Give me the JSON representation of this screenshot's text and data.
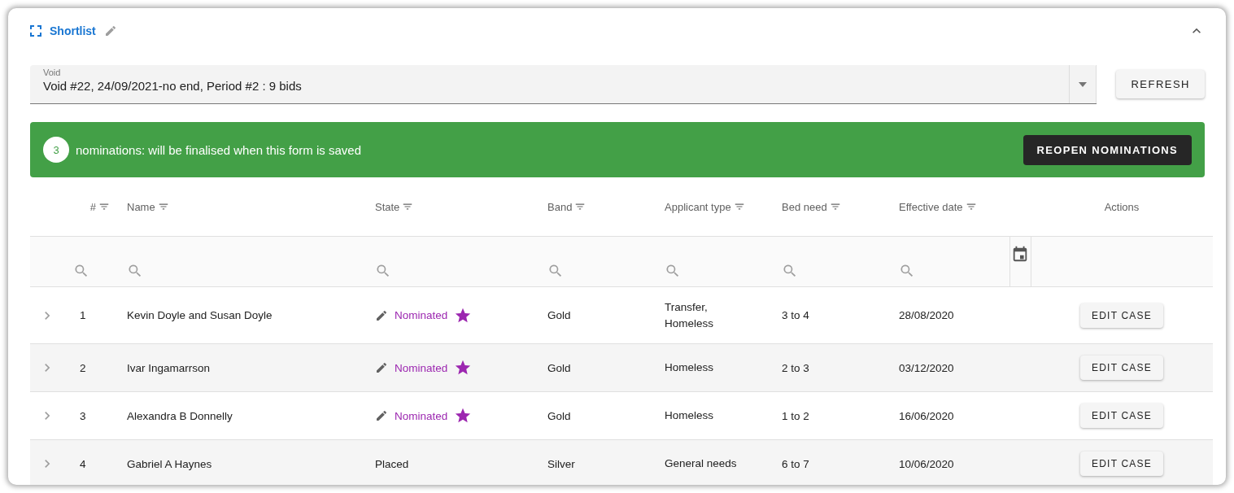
{
  "panel": {
    "title": "Shortlist"
  },
  "void_select": {
    "label": "Void",
    "value": "Void #22, 24/09/2021-no end, Period #2 : 9 bids"
  },
  "refresh_button": "REFRESH",
  "banner": {
    "count": "3",
    "message": "nominations: will be finalised when this form is saved",
    "button": "REOPEN NOMINATIONS"
  },
  "table": {
    "columns": [
      {
        "label": "#",
        "filter": true
      },
      {
        "label": "Name",
        "filter": true
      },
      {
        "label": "State",
        "filter": true
      },
      {
        "label": "Band",
        "filter": true
      },
      {
        "label": "Applicant type",
        "filter": true
      },
      {
        "label": "Bed need",
        "filter": true
      },
      {
        "label": "Effective date",
        "filter": true
      },
      {
        "label": "Actions",
        "filter": false
      }
    ],
    "rows": [
      {
        "num": "1",
        "name": "Kevin Doyle and Susan Doyle",
        "state": {
          "kind": "nominated",
          "text": "Nominated"
        },
        "band": "Gold",
        "applicant_type": "Transfer, Homeless",
        "bed_need": "3 to 4",
        "effective_date": "28/08/2020",
        "action": "EDIT CASE"
      },
      {
        "num": "2",
        "name": "Ivar Ingamarrson",
        "state": {
          "kind": "nominated",
          "text": "Nominated"
        },
        "band": "Gold",
        "applicant_type": "Homeless",
        "bed_need": "2 to 3",
        "effective_date": "03/12/2020",
        "action": "EDIT CASE"
      },
      {
        "num": "3",
        "name": "Alexandra B Donnelly",
        "state": {
          "kind": "nominated",
          "text": "Nominated"
        },
        "band": "Gold",
        "applicant_type": "Homeless",
        "bed_need": "1 to 2",
        "effective_date": "16/06/2020",
        "action": "EDIT CASE"
      },
      {
        "num": "4",
        "name": "Gabriel A Haynes",
        "state": {
          "kind": "plain",
          "text": "Placed"
        },
        "band": "Silver",
        "applicant_type": "General needs",
        "bed_need": "6 to 7",
        "effective_date": "10/06/2020",
        "action": "EDIT CASE"
      }
    ]
  }
}
